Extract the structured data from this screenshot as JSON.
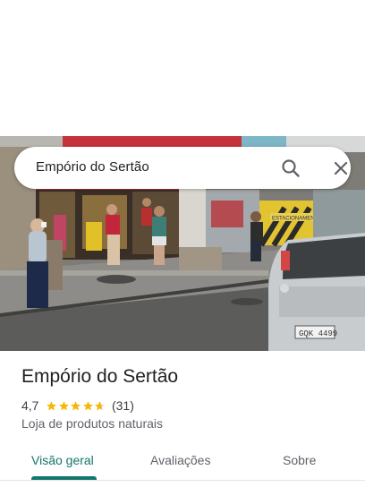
{
  "search": {
    "query": "Empório do Sertão",
    "search_icon": "search-icon",
    "close_icon": "close-icon"
  },
  "place": {
    "photo_icon": "storefront-photo",
    "name": "Empório do Sertão",
    "rating": "4,7",
    "rating_stars_value": 4.7,
    "review_count": "(31)",
    "category": "Loja de produtos naturais"
  },
  "photo_text": {
    "parking_sign": "ESTACIONAMENTO",
    "license_plate": "GQK 4499"
  },
  "tabs": [
    {
      "label": "Visão geral",
      "selected": true
    },
    {
      "label": "Avaliações",
      "selected": false
    },
    {
      "label": "Sobre",
      "selected": false
    }
  ],
  "colors": {
    "accent": "#12766b",
    "star": "#f6b705",
    "text_primary": "#202124",
    "text_secondary": "#5f6368"
  }
}
